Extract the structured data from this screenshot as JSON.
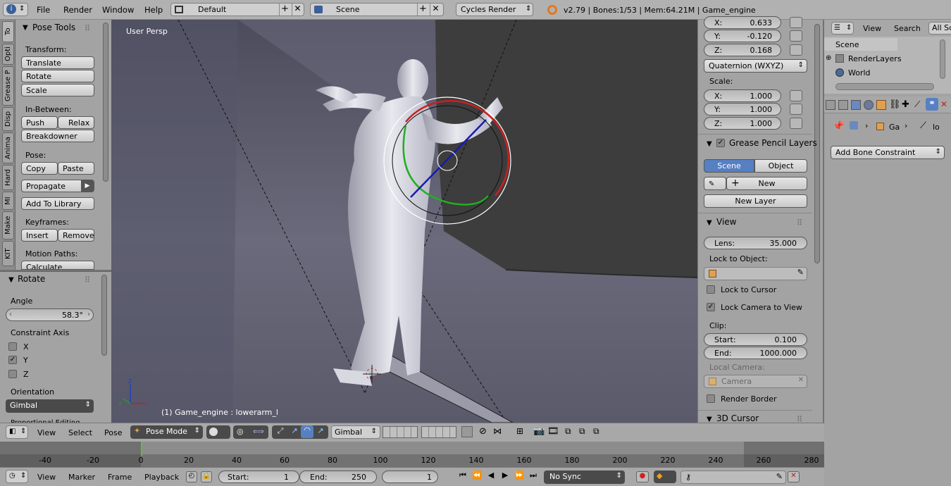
{
  "topbar": {
    "menus": [
      "File",
      "Render",
      "Window",
      "Help"
    ],
    "layout": "Default",
    "scene": "Scene",
    "engine": "Cycles Render",
    "info": "v2.79 | Bones:1/53 | Mem:64.21M | Game_engine"
  },
  "tool_tabs": [
    "To",
    "Opti",
    "Grease P",
    "Disp",
    "Anima",
    "Hard",
    "MI",
    "Make",
    "KIT"
  ],
  "pose_tools": {
    "title": "Pose Tools",
    "transform_label": "Transform:",
    "translate": "Translate",
    "rotate": "Rotate",
    "scale": "Scale",
    "inbetween_label": "In-Between:",
    "push": "Push",
    "relax": "Relax",
    "breakdowner": "Breakdowner",
    "pose_label": "Pose:",
    "copy": "Copy",
    "paste": "Paste",
    "propagate": "Propagate",
    "add_to_library": "Add To Library",
    "keyframes_label": "Keyframes:",
    "insert": "Insert",
    "remove": "Remove",
    "motion_paths_label": "Motion Paths:",
    "calculate": "Calculate"
  },
  "operator": {
    "title": "Rotate",
    "angle_label": "Angle",
    "angle_value": "58.3°",
    "constraint_label": "Constraint Axis",
    "axes": [
      {
        "label": "X",
        "checked": false
      },
      {
        "label": "Y",
        "checked": true
      },
      {
        "label": "Z",
        "checked": false
      }
    ],
    "orientation_label": "Orientation",
    "orientation_value": "Gimbal",
    "cut_text": "Proportional Editing"
  },
  "viewport": {
    "view_name": "User Persp",
    "status": "(1) Game_engine : lowerarm_l"
  },
  "right_panel": {
    "rot_x": "0.633",
    "rot_y": "-0.120",
    "rot_z": "0.168",
    "x_label": "X:",
    "y_label": "Y:",
    "z_label": "Z:",
    "rotation_mode": "Quaternion (WXYZ)",
    "scale_label": "Scale:",
    "scale_x": "1.000",
    "scale_y": "1.000",
    "scale_z": "1.000",
    "grease_title": "Grease Pencil Layers",
    "gp_scene": "Scene",
    "gp_object": "Object",
    "gp_new": "New",
    "gp_new_layer": "New Layer",
    "view_title": "View",
    "lens_label": "Lens:",
    "lens_value": "35.000",
    "lock_object_label": "Lock to Object:",
    "lock_cursor": "Lock to Cursor",
    "lock_camera": "Lock Camera to View",
    "clip_label": "Clip:",
    "clip_start_label": "Start:",
    "clip_start": "0.100",
    "clip_end_label": "End:",
    "clip_end": "1000.000",
    "local_camera_label": "Local Camera:",
    "local_camera": "Camera",
    "render_border": "Render Border",
    "cursor_title": "3D Cursor"
  },
  "outliner": {
    "view": "View",
    "search": "Search",
    "all_scenes": "All Sc",
    "items": [
      "Scene",
      "RenderLayers",
      "World"
    ]
  },
  "properties": {
    "crumb_object": "Ga",
    "crumb_bone": "lo",
    "add_constraint": "Add Bone Constraint"
  },
  "view3d_header": {
    "view": "View",
    "select": "Select",
    "pose": "Pose",
    "mode": "Pose Mode",
    "orientation": "Gimbal"
  },
  "timeline": {
    "ticks": [
      "-40",
      "-20",
      "0",
      "20",
      "40",
      "60",
      "80",
      "100",
      "120",
      "140",
      "160",
      "180",
      "200",
      "220",
      "240",
      "260",
      "280"
    ],
    "current_frame": 0
  },
  "timeline_header": {
    "view": "View",
    "marker": "Marker",
    "frame": "Frame",
    "playback": "Playback",
    "start_label": "Start:",
    "start": "1",
    "end_label": "End:",
    "end": "250",
    "current": "1",
    "sync": "No Sync"
  },
  "colors": {
    "panel": "#a3a3a3",
    "viewport": "#5f5f6f",
    "accent": "#5680c2",
    "frame_marker": "#60c040"
  }
}
